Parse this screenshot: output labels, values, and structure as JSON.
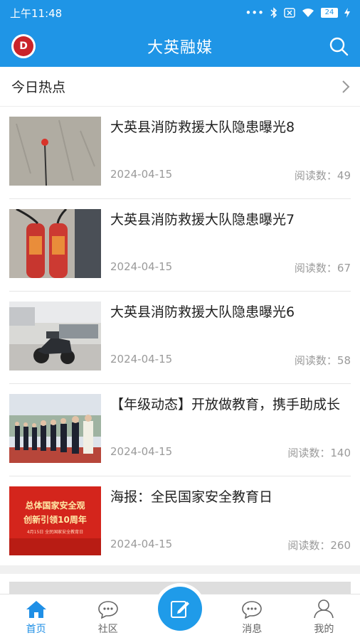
{
  "status_bar": {
    "time": "上午11:48",
    "battery": "24"
  },
  "app_bar": {
    "title": "大英融媒"
  },
  "section": {
    "label": "今日热点"
  },
  "news": [
    {
      "title": "大英县消防救援大队隐患曝光8",
      "date": "2024-04-15",
      "reads": "阅读数：49"
    },
    {
      "title": "大英县消防救援大队隐患曝光7",
      "date": "2024-04-15",
      "reads": "阅读数：67"
    },
    {
      "title": "大英县消防救援大队隐患曝光6",
      "date": "2024-04-15",
      "reads": "阅读数：58"
    },
    {
      "title": "【年级动态】开放做教育，携手助成长",
      "date": "2024-04-15",
      "reads": "阅读数：140"
    },
    {
      "title": "海报：全民国家安全教育日",
      "date": "2024-04-15",
      "reads": "阅读数：260",
      "poster_line1": "总体国家安全观",
      "poster_line2": "创新引领10周年",
      "poster_line3": "4月15日 全民国家安全教育日"
    }
  ],
  "tabs": [
    {
      "label": "首页",
      "icon": "home-icon"
    },
    {
      "label": "社区",
      "icon": "community-icon"
    },
    {
      "label": "",
      "icon": "edit-icon"
    },
    {
      "label": "消息",
      "icon": "message-icon"
    },
    {
      "label": "我的",
      "icon": "profile-icon"
    }
  ],
  "colors": {
    "primary": "#1f95e6",
    "active_tab": "#1f8fe6",
    "muted": "#9a9a9a"
  }
}
